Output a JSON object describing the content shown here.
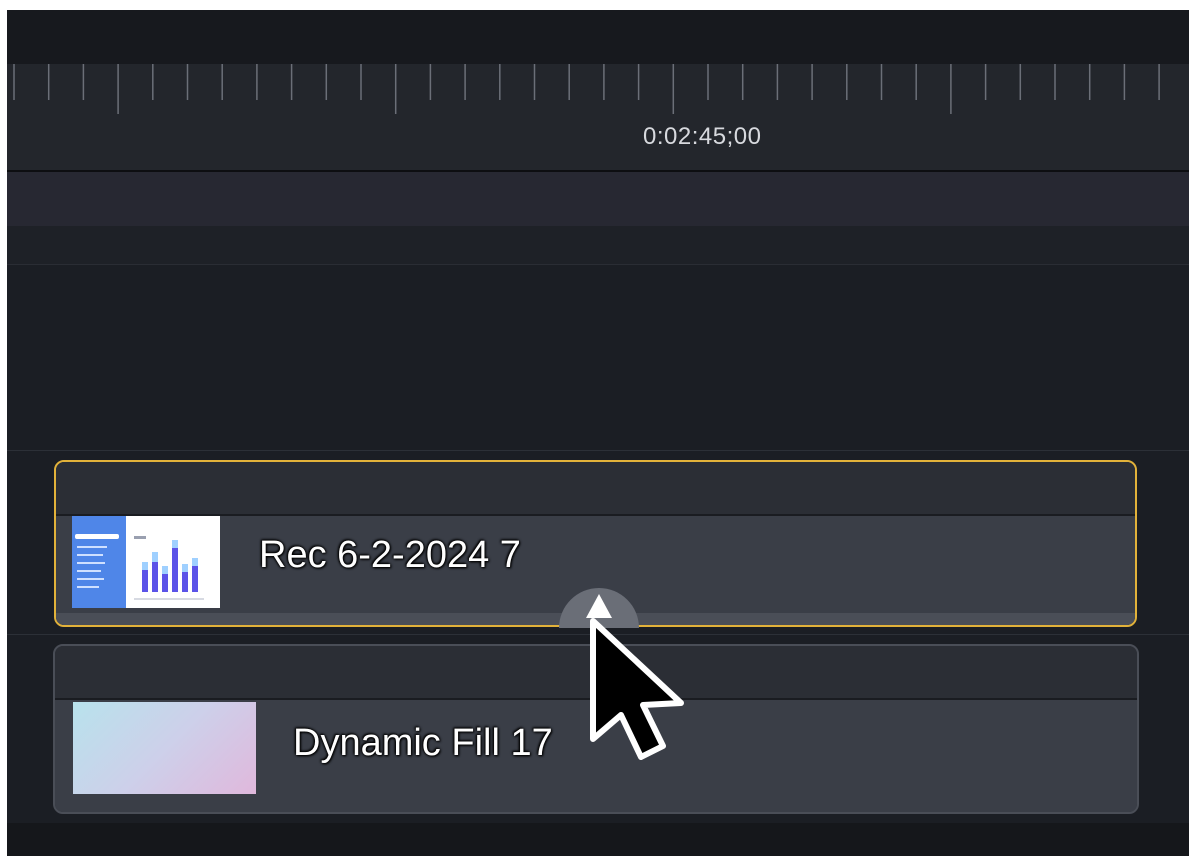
{
  "ruler": {
    "timecode": "0:02:45;00"
  },
  "clips": [
    {
      "label": "Rec 6-2-2024 7",
      "selected": true
    },
    {
      "label": "Dynamic Fill 17"
    }
  ],
  "colors": {
    "selection": "#e2b23a",
    "background": "#1b1e24",
    "clip_body": "#3a3e47"
  },
  "icons": {
    "handle": "triangle-up-icon",
    "cursor": "mouse-pointer-icon"
  }
}
